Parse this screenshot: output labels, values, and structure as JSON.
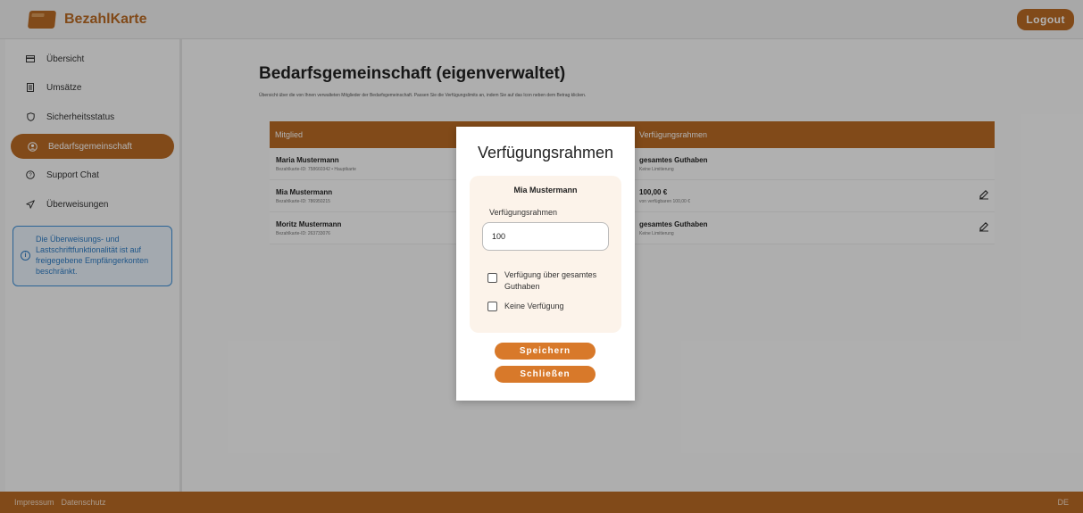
{
  "header": {
    "brand": "BezahlKarte",
    "logout_label": "Logout"
  },
  "sidebar": {
    "items": [
      {
        "label": "Übersicht",
        "icon": "card-icon"
      },
      {
        "label": "Umsätze",
        "icon": "receipt-icon"
      },
      {
        "label": "Sicherheitsstatus",
        "icon": "shield-icon"
      },
      {
        "label": "Bedarfsgemeinschaft",
        "icon": "group-icon",
        "active": true
      },
      {
        "label": "Support Chat",
        "icon": "help-icon"
      },
      {
        "label": "Überweisungen",
        "icon": "send-icon"
      }
    ],
    "info": "Die Überweisungs- und Lastschriftfunktionalität ist auf freigegebene Empfängerkonten beschränkt."
  },
  "main": {
    "title": "Bedarfsgemeinschaft (eigenverwaltet)",
    "subtitle": "Übersicht über die von Ihnen verwalteten Mitglieder der Bedarfsgemeinschaft. Passen Sie die Verfügungslimits an, indem Sie auf das Icon neben dem Betrag klicken.",
    "table": {
      "col_member": "Mitglied",
      "col_limit": "Verfügungsrahmen",
      "rows": [
        {
          "name": "Maria Mustermann",
          "id": "Bezahlkarte-ID: 758660342 • Hauptkarte",
          "limit": "gesamtes Guthaben",
          "limit_sub": "Keine Limitierung"
        },
        {
          "name": "Mia Mustermann",
          "id": "Bezahlkarte-ID: 786950215",
          "limit": "100,00 €",
          "limit_sub": "von verfügbaren 100,00 €"
        },
        {
          "name": "Moritz Mustermann",
          "id": "Bezahlkarte-ID: 263733076",
          "limit": "gesamtes Guthaben",
          "limit_sub": "Keine Limitierung"
        }
      ]
    }
  },
  "footer": {
    "impressum": "Impressum",
    "datenschutz": "Datenschutz",
    "lang": "DE"
  },
  "modal": {
    "title": "Verfügungsrahmen",
    "member": "Mia Mustermann",
    "field_label": "Verfügungsrahmen",
    "field_value": "100",
    "check_all": "Verfügung über gesamtes Guthaben",
    "check_none": "Keine Verfügung",
    "save_label": "Speichern",
    "close_label": "Schließen"
  }
}
